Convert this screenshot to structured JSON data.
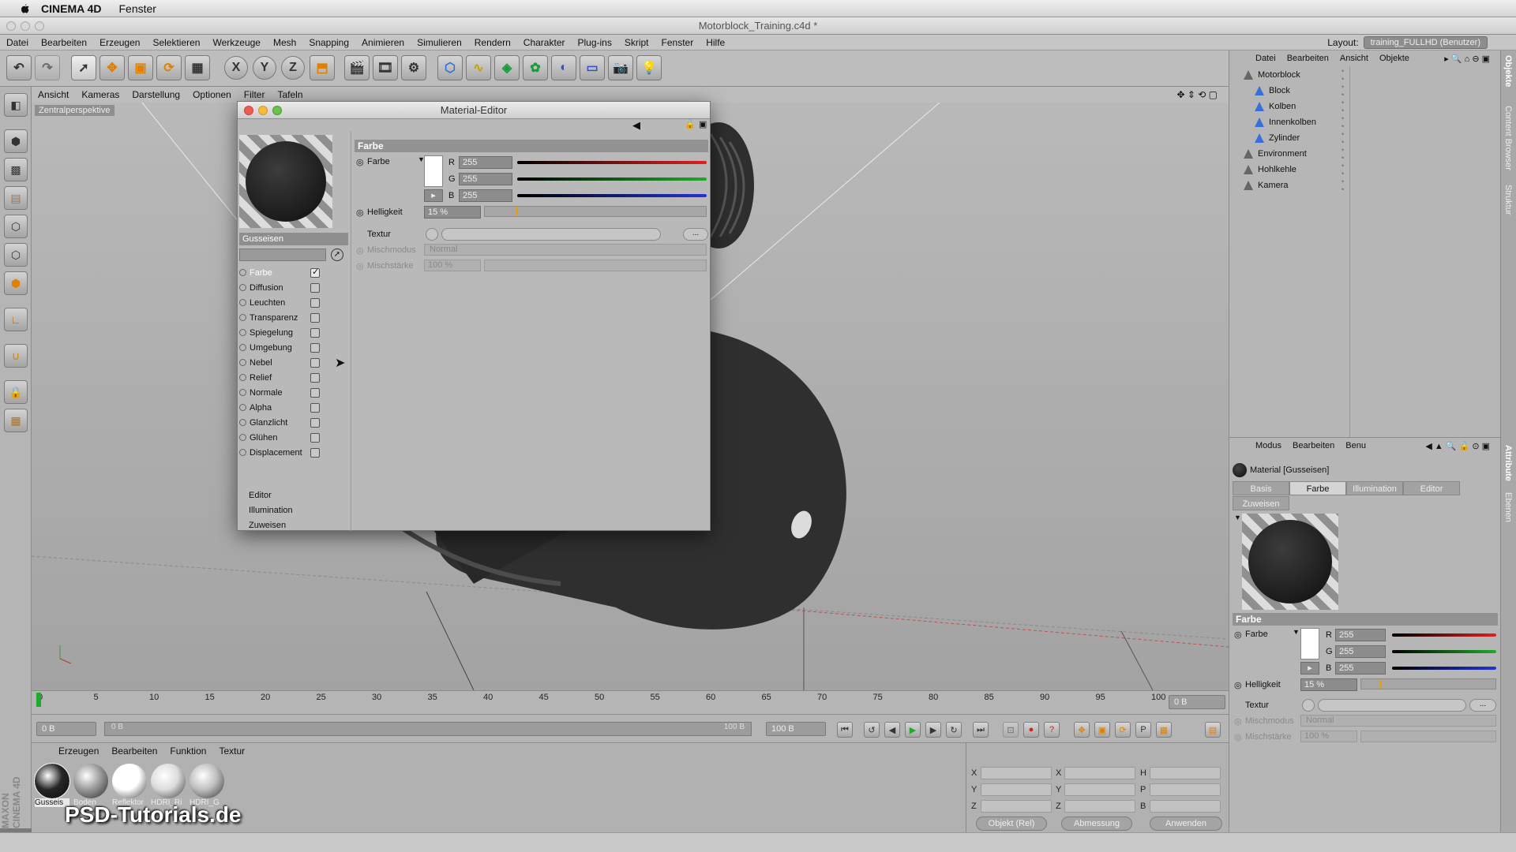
{
  "menubar_mac": {
    "app": "CINEMA 4D",
    "window": "Fenster"
  },
  "window": {
    "title": "Motorblock_Training.c4d *"
  },
  "main_menu": [
    "Datei",
    "Bearbeiten",
    "Erzeugen",
    "Selektieren",
    "Werkzeuge",
    "Mesh",
    "Snapping",
    "Animieren",
    "Simulieren",
    "Rendern",
    "Charakter",
    "Plug-ins",
    "Skript",
    "Fenster",
    "Hilfe"
  ],
  "layout": {
    "label": "Layout:",
    "value": "training_FULLHD (Benutzer)"
  },
  "toolbar": {
    "x": "X",
    "y": "Y",
    "z": "Z"
  },
  "viewport": {
    "menu": [
      "Ansicht",
      "Kameras",
      "Darstellung",
      "Optionen",
      "Filter",
      "Tafeln"
    ],
    "label": "Zentralperspektive"
  },
  "timeline": {
    "ticks": [
      "0",
      "5",
      "10",
      "15",
      "20",
      "25",
      "30",
      "35",
      "40",
      "45",
      "50",
      "55",
      "60",
      "65",
      "70",
      "75",
      "80",
      "85",
      "90",
      "95",
      "100"
    ],
    "frame_field": "0 B"
  },
  "transport": {
    "start": "0 B",
    "range_left": "0 B",
    "range_right": "100 B",
    "end": "100 B"
  },
  "material_manager": {
    "menu": [
      "Erzeugen",
      "Bearbeiten",
      "Funktion",
      "Textur"
    ],
    "materials": [
      {
        "name": "Gusseis",
        "color": "#262626"
      },
      {
        "name": "Boden",
        "color": "#9a9a9a"
      },
      {
        "name": "Reflektor",
        "color": "#ffffff"
      },
      {
        "name": "HDRI_Ri",
        "color": "#dcdcdc"
      },
      {
        "name": "HDRI_G",
        "color": "#bfbfbf"
      }
    ]
  },
  "coordinates": {
    "labels_pos": [
      "X",
      "Y",
      "Z"
    ],
    "labels_size": [
      "X",
      "Y",
      "Z"
    ],
    "labels_rot": [
      "H",
      "P",
      "B"
    ],
    "mode": "Objekt (Rel)",
    "size_mode": "Abmessung",
    "apply": "Anwenden"
  },
  "watermark": {
    "brand": "PSD-Tutorials.de",
    "maxon": "MAXON CINEMA 4D"
  },
  "object_manager": {
    "menu": [
      "Datei",
      "Bearbeiten",
      "Ansicht",
      "Objekte"
    ],
    "objects": [
      {
        "name": "Motorblock",
        "indent": 0
      },
      {
        "name": "Block",
        "indent": 1
      },
      {
        "name": "Kolben",
        "indent": 1
      },
      {
        "name": "Innenkolben",
        "indent": 1
      },
      {
        "name": "Zylinder",
        "indent": 1
      },
      {
        "name": "Environment",
        "indent": 0
      },
      {
        "name": "Hohlkehle",
        "indent": 0
      },
      {
        "name": "Kamera",
        "indent": 0
      }
    ]
  },
  "right_tabs": [
    "Objekte",
    "Content Browser",
    "Struktur",
    "Attribute",
    "Ebenen"
  ],
  "attribute_manager": {
    "menu": [
      "Modus",
      "Bearbeiten",
      "Benu"
    ],
    "title": "Material [Gusseisen]",
    "tabs": [
      "Basis",
      "Farbe",
      "Illumination",
      "Editor",
      "Zuweisen"
    ],
    "active_tab": "Farbe",
    "section": "Farbe",
    "farbe_label": "Farbe",
    "r_label": "R",
    "g_label": "G",
    "b_label": "B",
    "r": "255",
    "g": "255",
    "b": "255",
    "helligkeit_label": "Helligkeit",
    "helligkeit": "15 %",
    "textur_label": "Textur",
    "mischmodus_label": "Mischmodus",
    "mischmodus": "Normal",
    "mischstaerke_label": "Mischstärke",
    "mischstaerke": "100 %",
    "more": "..."
  },
  "material_editor": {
    "title": "Material-Editor",
    "material_name": "Gusseisen",
    "channels": [
      {
        "label": "Farbe",
        "checked": true,
        "selected": true
      },
      {
        "label": "Diffusion",
        "checked": false
      },
      {
        "label": "Leuchten",
        "checked": false
      },
      {
        "label": "Transparenz",
        "checked": false
      },
      {
        "label": "Spiegelung",
        "checked": false
      },
      {
        "label": "Umgebung",
        "checked": false
      },
      {
        "label": "Nebel",
        "checked": false
      },
      {
        "label": "Relief",
        "checked": false
      },
      {
        "label": "Normale",
        "checked": false
      },
      {
        "label": "Alpha",
        "checked": false
      },
      {
        "label": "Glanzlicht",
        "checked": false
      },
      {
        "label": "Glühen",
        "checked": false
      },
      {
        "label": "Displacement",
        "checked": false
      }
    ],
    "extras": [
      "Editor",
      "Illumination",
      "Zuweisen"
    ],
    "section": "Farbe",
    "farbe_label": "Farbe",
    "r_label": "R",
    "g_label": "G",
    "b_label": "B",
    "r": "255",
    "g": "255",
    "b": "255",
    "helligkeit_label": "Helligkeit",
    "helligkeit": "15 %",
    "helligkeit_fraction": 0.15,
    "textur_label": "Textur",
    "mischmodus_label": "Mischmodus",
    "mischmodus": "Normal",
    "mischstaerke_label": "Mischstärke",
    "mischstaerke": "100 %",
    "more": "..."
  },
  "colors": {
    "red": "#e02020",
    "green": "#1faa2a",
    "blue": "#2233d8",
    "accent_orange": "#e8a000"
  }
}
